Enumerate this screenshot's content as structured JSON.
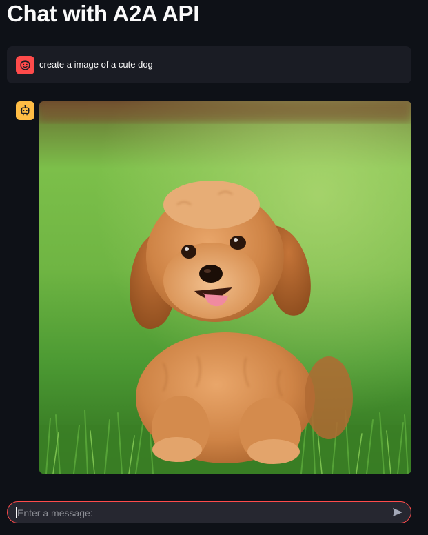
{
  "page": {
    "title": "Chat with A2A API"
  },
  "messages": [
    {
      "role": "user",
      "avatar_icon": "face-icon",
      "text": "create a image of a cute dog"
    },
    {
      "role": "assistant",
      "avatar_icon": "robot-icon",
      "content_type": "image",
      "image_subject": "cute-dog"
    }
  ],
  "chat_input": {
    "placeholder": "Enter a message:",
    "value": "",
    "send_icon": "send-icon"
  },
  "colors": {
    "background": "#0e1117",
    "user_avatar": "#ff4b4b",
    "assistant_avatar": "#ffbd45",
    "input_border": "#ff4b4b",
    "message_bg": "#1a1c24"
  }
}
